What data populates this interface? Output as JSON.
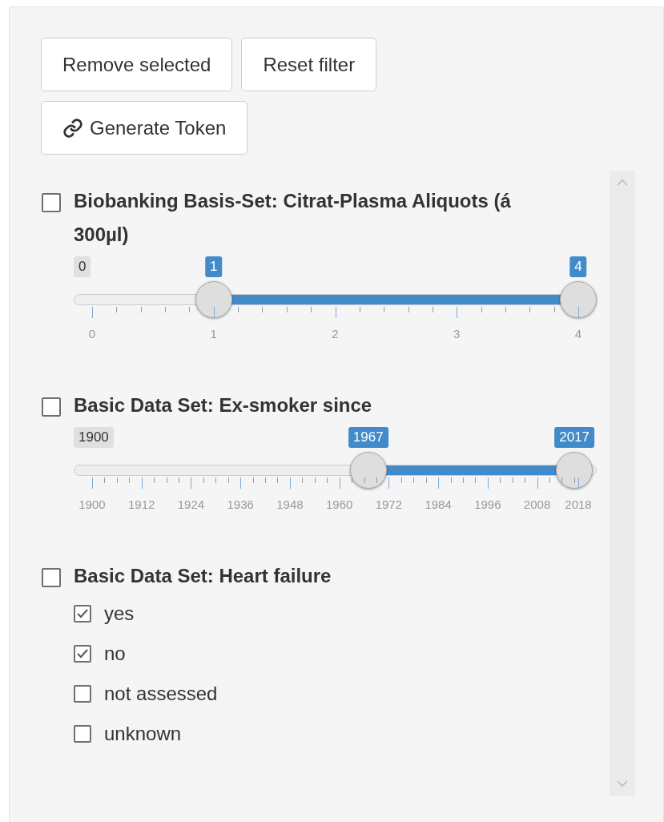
{
  "buttons": [
    {
      "label": "Remove selected",
      "kind": "plain"
    },
    {
      "label": "Reset filter",
      "kind": "plain"
    },
    {
      "label": "Generate Token",
      "kind": "link"
    }
  ],
  "filters": [
    {
      "kind": "slider",
      "title": "Biobanking Basis-Set: Citrat-Plasma Aliquots (á 300µl)",
      "checked": false,
      "min_label": "0",
      "from": {
        "label": "1",
        "level": 0.25
      },
      "to": {
        "label": "4",
        "level": 1
      },
      "ticks": [
        "0",
        "1",
        "2",
        "3",
        "4"
      ]
    },
    {
      "kind": "slider",
      "title": "Basic Data Set: Ex-smoker since",
      "checked": false,
      "min_label": "1900",
      "from": {
        "label": "1967",
        "level": 0.568
      },
      "to": {
        "label": "2017",
        "level": 0.992
      },
      "ticks": [
        "1900",
        "1912",
        "1924",
        "1936",
        "1948",
        "1960",
        "1972",
        "1984",
        "1996",
        "2008",
        "2018"
      ]
    },
    {
      "kind": "choices",
      "title": "Basic Data Set: Heart failure",
      "checked": false,
      "options": [
        {
          "label": "yes",
          "checked": true
        },
        {
          "label": "no",
          "checked": true
        },
        {
          "label": "not assessed",
          "checked": false
        },
        {
          "label": "unknown",
          "checked": false
        }
      ]
    }
  ]
}
